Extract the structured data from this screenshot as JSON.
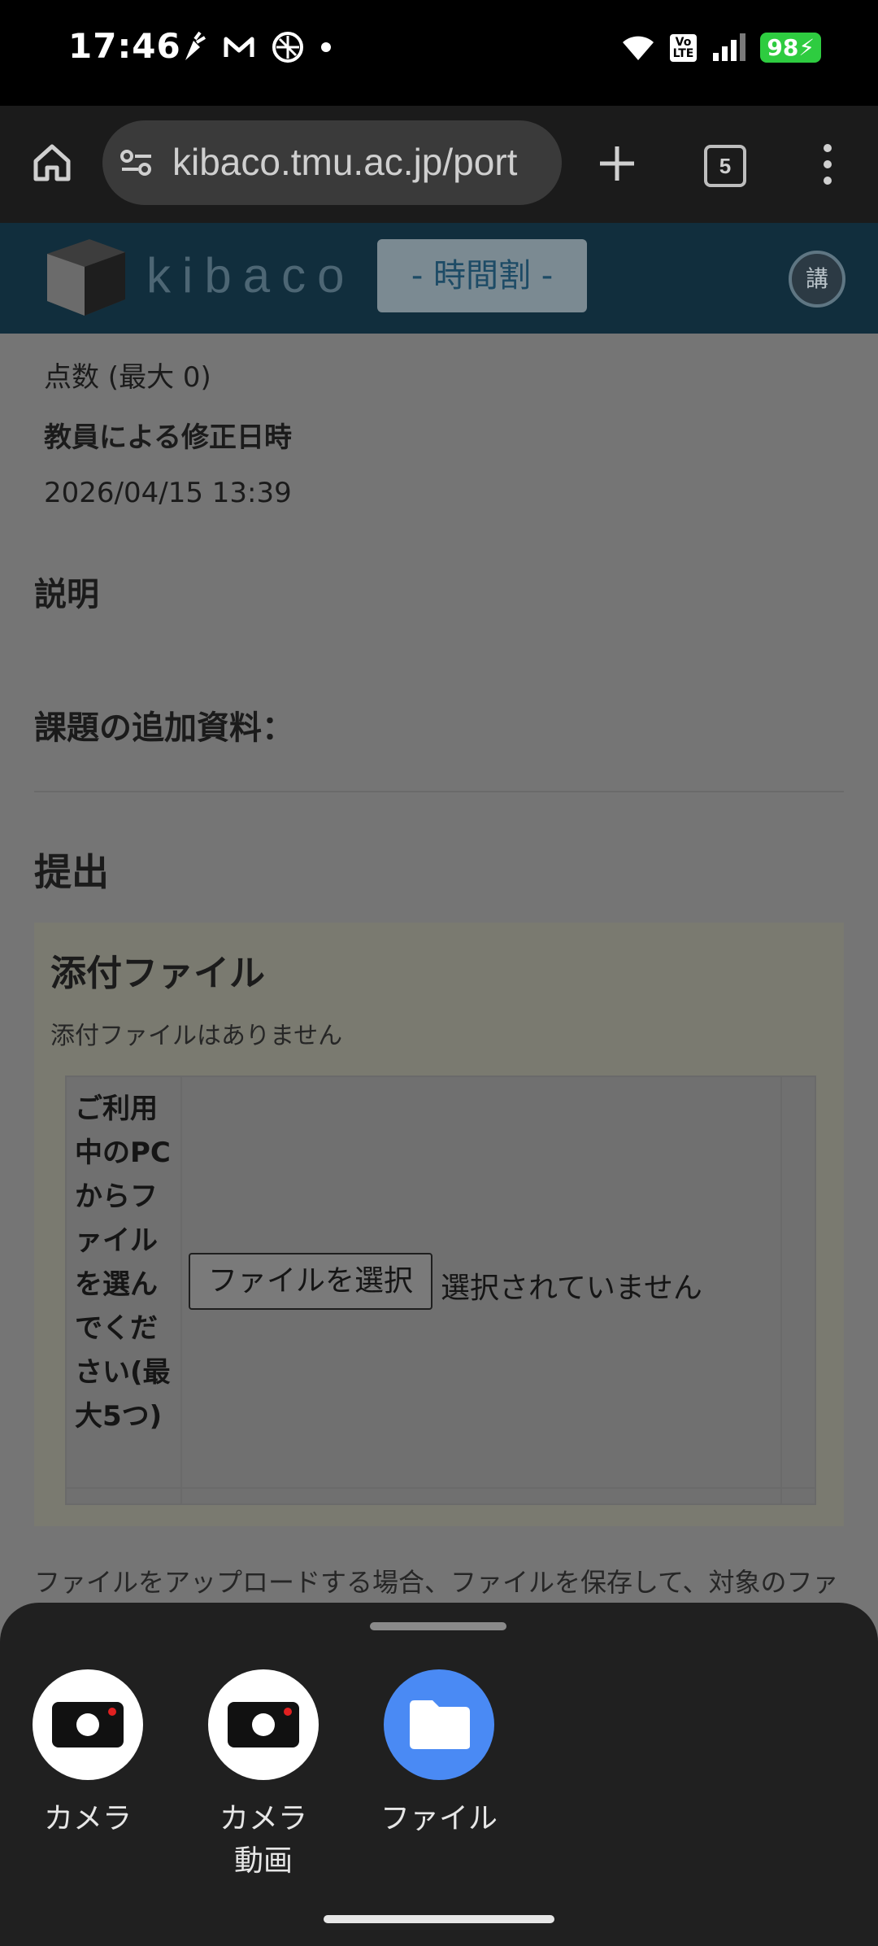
{
  "status_bar": {
    "time": "17:46",
    "battery": "98",
    "lte_label": "Vo\nLTE",
    "icons_left": [
      "carrot-icon",
      "gmail-icon",
      "vpn-icon",
      "dot-icon"
    ],
    "icons_right": [
      "wifi-icon",
      "volte-icon",
      "signal-icon",
      "battery-icon"
    ]
  },
  "browser": {
    "url": "kibaco.tmu.ac.jp/port",
    "tab_count": "5"
  },
  "site_header": {
    "logo_text": "kibaco",
    "timetable_button": "- 時間割 -",
    "avatar_text": "講"
  },
  "content": {
    "score_label": "点数 (最大 0)",
    "modified_label": "教員による修正日時",
    "modified_date": "2026/04/15 13:39",
    "description_heading": "説明",
    "additional_materials_heading": "課題の追加資料：",
    "submission_heading": "提出",
    "attachments_heading": "添付ファイル",
    "no_attachments": "添付ファイルはありません",
    "choose_from_pc": "ご利用中のPCからファイルを選んでください(最大5つ)",
    "choose_file_button": "ファイルを選択",
    "no_file_selected": "選択されていません",
    "upload_note": "ファイルをアップロードする場合、ファイルを保存して、対象のファ"
  },
  "bottom_sheet": {
    "options": [
      {
        "label": "カメラ",
        "icon": "camera-icon"
      },
      {
        "label": "カメラ\n動画",
        "icon": "camera-video-icon"
      },
      {
        "label": "ファイル",
        "icon": "folder-icon"
      }
    ]
  },
  "colors": {
    "accent_blue": "#4a8af4",
    "header_bg": "#112e3d",
    "battery_green": "#2ecc40"
  }
}
